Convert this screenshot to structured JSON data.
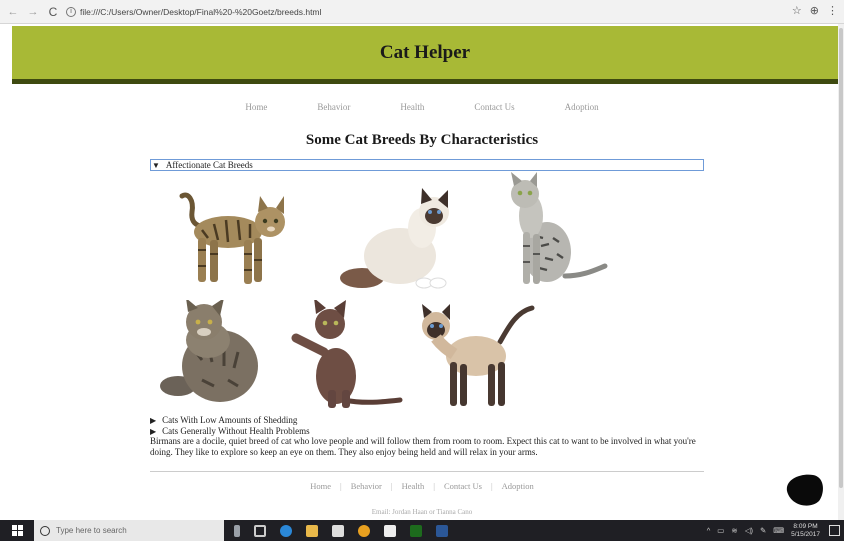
{
  "browser": {
    "url": "file:///C:/Users/Owner/Desktop/Final%20-%20Goetz/breeds.html",
    "back_icon": "back-arrow-icon",
    "forward_icon": "forward-arrow-icon",
    "reload_icon": "reload-icon"
  },
  "site": {
    "title": "Cat Helper",
    "banner_color": "#a8b936",
    "banner_border_color": "#3e4a10"
  },
  "nav": {
    "items": [
      "Home",
      "Behavior",
      "Health",
      "Contact Us",
      "Adoption"
    ]
  },
  "main": {
    "heading": "Some Cat Breeds By Characteristics",
    "sections": [
      {
        "label": "Affectionate Cat Breeds",
        "open": true
      },
      {
        "label": "Cats With Low Amounts of Shedding",
        "open": false
      },
      {
        "label": "Cats Generally Without Health Problems",
        "open": false
      }
    ],
    "paragraph": "Birmans are a docile, quiet breed of cat who love people and will follow them from room to room. Expect this cat to want to be involved in what you're doing. They like to explore so keep an eye on them. They also enjoy being held and will relax in your arms."
  },
  "footer": {
    "nav": [
      "Home",
      "Behavior",
      "Health",
      "Contact Us",
      "Adoption"
    ],
    "email": "Email: Jordan Haan or Tianna Cano"
  },
  "taskbar": {
    "search_placeholder": "Type here to search",
    "clock_time": "8:09 PM",
    "clock_date": "5/15/2017"
  }
}
